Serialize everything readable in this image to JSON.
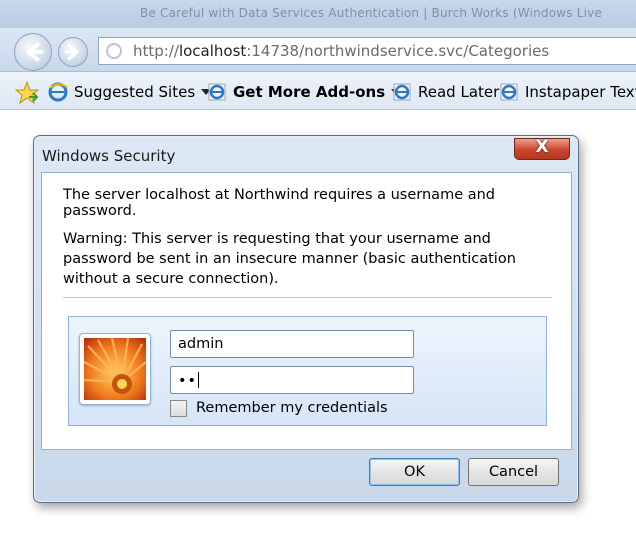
{
  "browser": {
    "faded_title": "Be Careful with Data Services Authentication | Burch Works (Windows Live",
    "address_prefix": "http://",
    "address_host": "localhost",
    "address_rest": ":14738/northwindservice.svc/Categories",
    "favorites": [
      {
        "label": "Suggested Sites",
        "icon": "ie-icon",
        "dropdown": true
      },
      {
        "label": "Get More Add-ons",
        "icon": "ie-icon",
        "dropdown": true,
        "bold": true
      },
      {
        "label": "Read Later",
        "icon": "ie-icon"
      },
      {
        "label": "Instapaper Text",
        "icon": "ie-icon"
      }
    ]
  },
  "dialog": {
    "title": "Windows Security",
    "close_label": "X",
    "message": "The server localhost at Northwind requires a username and password.",
    "warning": "Warning: This server is requesting that your username and password be sent in an insecure manner (basic authentication without a secure connection).",
    "username_value": "admin",
    "password_mask": "••",
    "remember_label": "Remember my credentials",
    "ok_label": "OK",
    "cancel_label": "Cancel"
  },
  "colors": {
    "chrome_blue": "#c8d8ec",
    "close_red": "#c9462f",
    "credential_panel": "#d6e5f7"
  }
}
